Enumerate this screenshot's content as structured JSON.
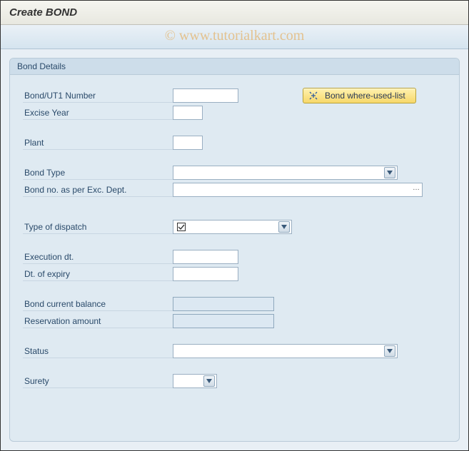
{
  "header": {
    "title": "Create BOND"
  },
  "watermark": "© www.tutorialkart.com",
  "groupbox": {
    "title": "Bond Details"
  },
  "buttons": {
    "where_used": "Bond where-used-list"
  },
  "fields": {
    "bond_ut1_number": {
      "label": "Bond/UT1 Number",
      "value": ""
    },
    "excise_year": {
      "label": "Excise Year",
      "value": ""
    },
    "plant": {
      "label": "Plant",
      "value": ""
    },
    "bond_type": {
      "label": "Bond Type",
      "value": ""
    },
    "bond_no_exc_dept": {
      "label": "Bond no. as per Exc. Dept.",
      "value": ""
    },
    "type_of_dispatch": {
      "label": "Type of dispatch",
      "value": ""
    },
    "execution_dt": {
      "label": "Execution dt.",
      "value": ""
    },
    "dt_of_expiry": {
      "label": "Dt. of expiry",
      "value": ""
    },
    "bond_current_balance": {
      "label": "Bond current balance",
      "value": ""
    },
    "reservation_amount": {
      "label": "Reservation amount",
      "value": ""
    },
    "status": {
      "label": "Status",
      "value": ""
    },
    "surety": {
      "label": "Surety",
      "value": ""
    }
  }
}
